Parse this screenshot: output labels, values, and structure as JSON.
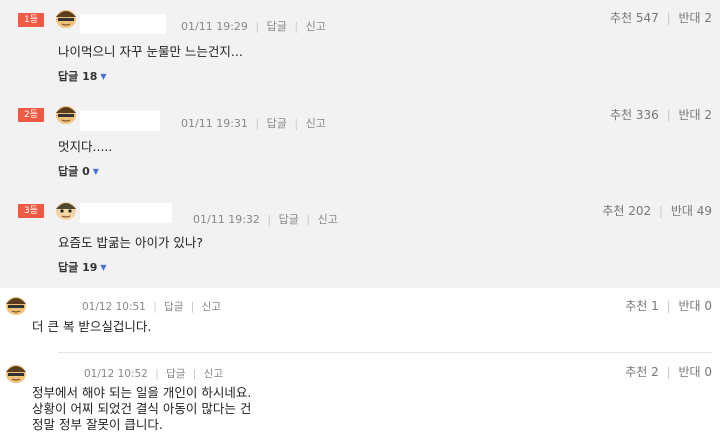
{
  "best_comments": [
    {
      "rank": "1등",
      "date": "01/11 19:29",
      "reply_label": "답글",
      "report_label": "신고",
      "votes_up": "추천 547",
      "votes_down": "반대 2",
      "text": "나이먹으니 자꾸 눈물만 느는건지...",
      "replies": "답글 18"
    },
    {
      "rank": "2등",
      "date": "01/11 19:31",
      "reply_label": "답글",
      "report_label": "신고",
      "votes_up": "추천 336",
      "votes_down": "반대 2",
      "text": "멋지다.....",
      "replies": "답글 0"
    },
    {
      "rank": "3등",
      "date": "01/11 19:32",
      "reply_label": "답글",
      "report_label": "신고",
      "votes_up": "추천 202",
      "votes_down": "반대 49",
      "text": "요즘도 밥굶는 아이가 있나?",
      "replies": "답글 19"
    }
  ],
  "comments": [
    {
      "date": "01/12 10:51",
      "reply_label": "답글",
      "report_label": "신고",
      "votes_up": "추천 1",
      "votes_down": "반대 0",
      "lines": [
        "더 큰 복 받으실겁니다."
      ]
    },
    {
      "date": "01/12 10:52",
      "reply_label": "답글",
      "report_label": "신고",
      "votes_up": "추천 2",
      "votes_down": "반대 0",
      "lines": [
        "정부에서 해야 되는 일을 개인이 하시네요.",
        "상황이 어찌 되었건 결식 아동이 많다는 건",
        "정말 정부 잘못이 큽니다."
      ]
    }
  ],
  "colors": {
    "rank_badge": "#ef5a45",
    "best_bg": "#f2f2f2",
    "caret": "#4a6fd8"
  },
  "icons": {
    "avatar": "cartoon-face-icon",
    "caret": "caret-down-icon"
  }
}
